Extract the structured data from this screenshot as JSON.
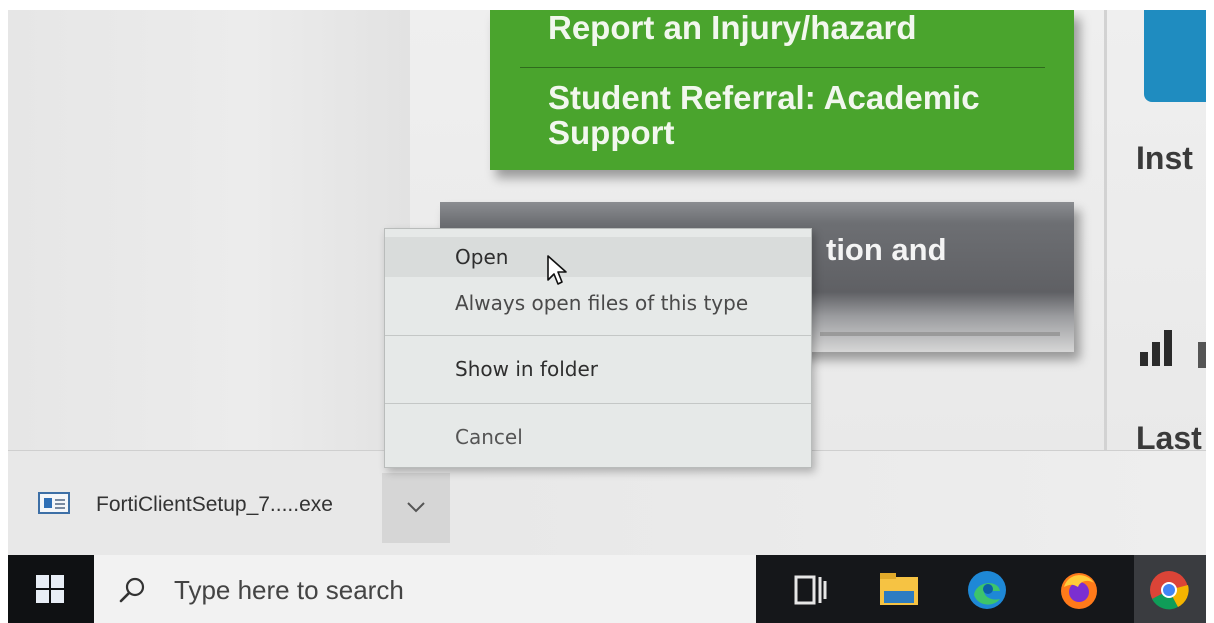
{
  "page": {
    "green_links": [
      "Report an Injury/hazard",
      "Student Referral: Academic Support"
    ],
    "grey_card_text": "tion and",
    "side_labels": {
      "top": "Inst",
      "bottom": "Last"
    },
    "colors": {
      "green_card": "#4aa42d",
      "menu_bg": "#e6e9e8",
      "taskbar": "#15171a"
    }
  },
  "context_menu": {
    "items": [
      {
        "label": "Open"
      },
      {
        "label": "Always open files of this type"
      },
      {
        "label": "Show in folder"
      },
      {
        "label": "Cancel"
      }
    ]
  },
  "download_shelf": {
    "file_name": "FortiClientSetup_7.....exe",
    "file_icon": "installer-icon",
    "menu_button_icon": "chevron-down-icon"
  },
  "taskbar": {
    "search_placeholder": "Type here to search",
    "icons": [
      "windows-start-icon",
      "search-icon",
      "task-view-icon",
      "file-explorer-icon",
      "edge-icon",
      "firefox-icon",
      "chrome-icon"
    ]
  }
}
